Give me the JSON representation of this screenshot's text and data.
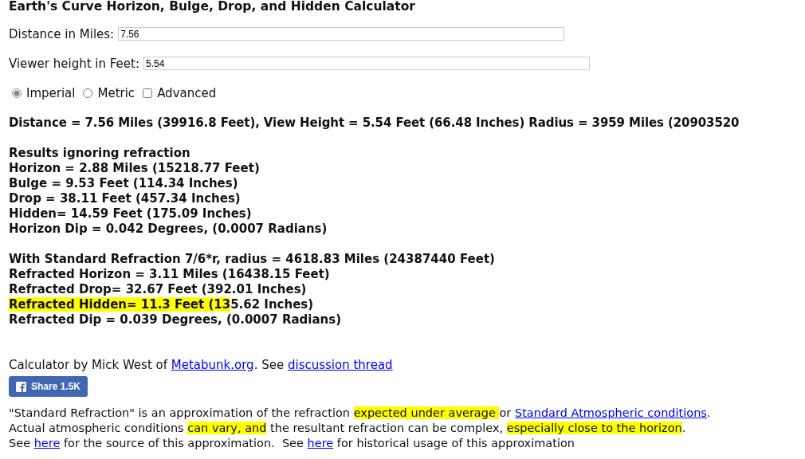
{
  "title": "Earth's Curve Horizon, Bulge, Drop, and Hidden Calculator",
  "fields": [
    {
      "label": "Distance in Miles:",
      "value": "7.56"
    },
    {
      "label": "Viewer height in Feet:",
      "value": "5.54"
    }
  ],
  "options": [
    {
      "kind": "radio",
      "label": "Imperial",
      "checked": true
    },
    {
      "kind": "radio",
      "label": "Metric",
      "checked": false
    },
    {
      "kind": "checkbox",
      "label": "Advanced",
      "checked": false
    }
  ],
  "summary": "Distance = 7.56 Miles (39916.8 Feet), View Height = 5.54 Feet (66.48 Inches) Radius = 3959 Miles (20903520",
  "result_groups": [
    {
      "heading": "Results ignoring refraction",
      "lines": [
        [
          {
            "kind": "text",
            "text": "Horizon = 2.88 Miles (15218.77 Feet)"
          }
        ],
        [
          {
            "kind": "text",
            "text": "Bulge = 9.53 Feet (114.34 Inches)"
          }
        ],
        [
          {
            "kind": "text",
            "text": "Drop = 38.11 Feet (457.34 Inches)"
          }
        ],
        [
          {
            "kind": "text",
            "text": "Hidden= 14.59 Feet (175.09 Inches)"
          }
        ],
        [
          {
            "kind": "text",
            "text": "Horizon Dip = 0.042 Degrees, (0.0007 Radians)"
          }
        ]
      ]
    },
    {
      "heading": "With Standard Refraction 7/6*r, radius = 4618.83 Miles (24387440 Feet)",
      "lines": [
        [
          {
            "kind": "text",
            "text": "Refracted Horizon = 3.11 Miles (16438.15 Feet)"
          }
        ],
        [
          {
            "kind": "text",
            "text": "Refracted Drop= 32.67 Feet (392.01 Inches)"
          }
        ],
        [
          {
            "kind": "highlight",
            "text": "Refracted Hidden= 11.3 Feet (13"
          },
          {
            "kind": "text",
            "text": "5.62 Inches)"
          }
        ],
        [
          {
            "kind": "text",
            "text": "Refracted Dip = 0.039 Degrees, (0.0007 Radians)"
          }
        ]
      ]
    }
  ],
  "credit": [
    {
      "kind": "text",
      "text": "Calculator by Mick West of "
    },
    {
      "kind": "link",
      "text": "Metabunk.org"
    },
    {
      "kind": "text",
      "text": ". See "
    },
    {
      "kind": "link",
      "text": "discussion thread"
    }
  ],
  "share_button": {
    "label": "Share 1.5K"
  },
  "note_lines": [
    [
      {
        "kind": "text",
        "text": "\"Standard Refraction\" is an approximation of the refraction "
      },
      {
        "kind": "highlight",
        "text": "expected under average "
      },
      {
        "kind": "text",
        "text": "or "
      },
      {
        "kind": "link",
        "text": "Standard Atmospheric conditions"
      },
      {
        "kind": "text",
        "text": "."
      }
    ],
    [
      {
        "kind": "text",
        "text": "Actual atmospheric conditions "
      },
      {
        "kind": "highlight",
        "text": "can vary, and"
      },
      {
        "kind": "text",
        "text": " the resultant refraction can be complex, "
      },
      {
        "kind": "highlight",
        "text": "especially close to the horizon"
      },
      {
        "kind": "text",
        "text": "."
      }
    ],
    [
      {
        "kind": "text",
        "text": "See "
      },
      {
        "kind": "link",
        "text": "here"
      },
      {
        "kind": "text",
        "text": " for the source of this approximation.  See "
      },
      {
        "kind": "link",
        "text": "here"
      },
      {
        "kind": "text",
        "text": " for historical usage of this approximation"
      }
    ]
  ]
}
